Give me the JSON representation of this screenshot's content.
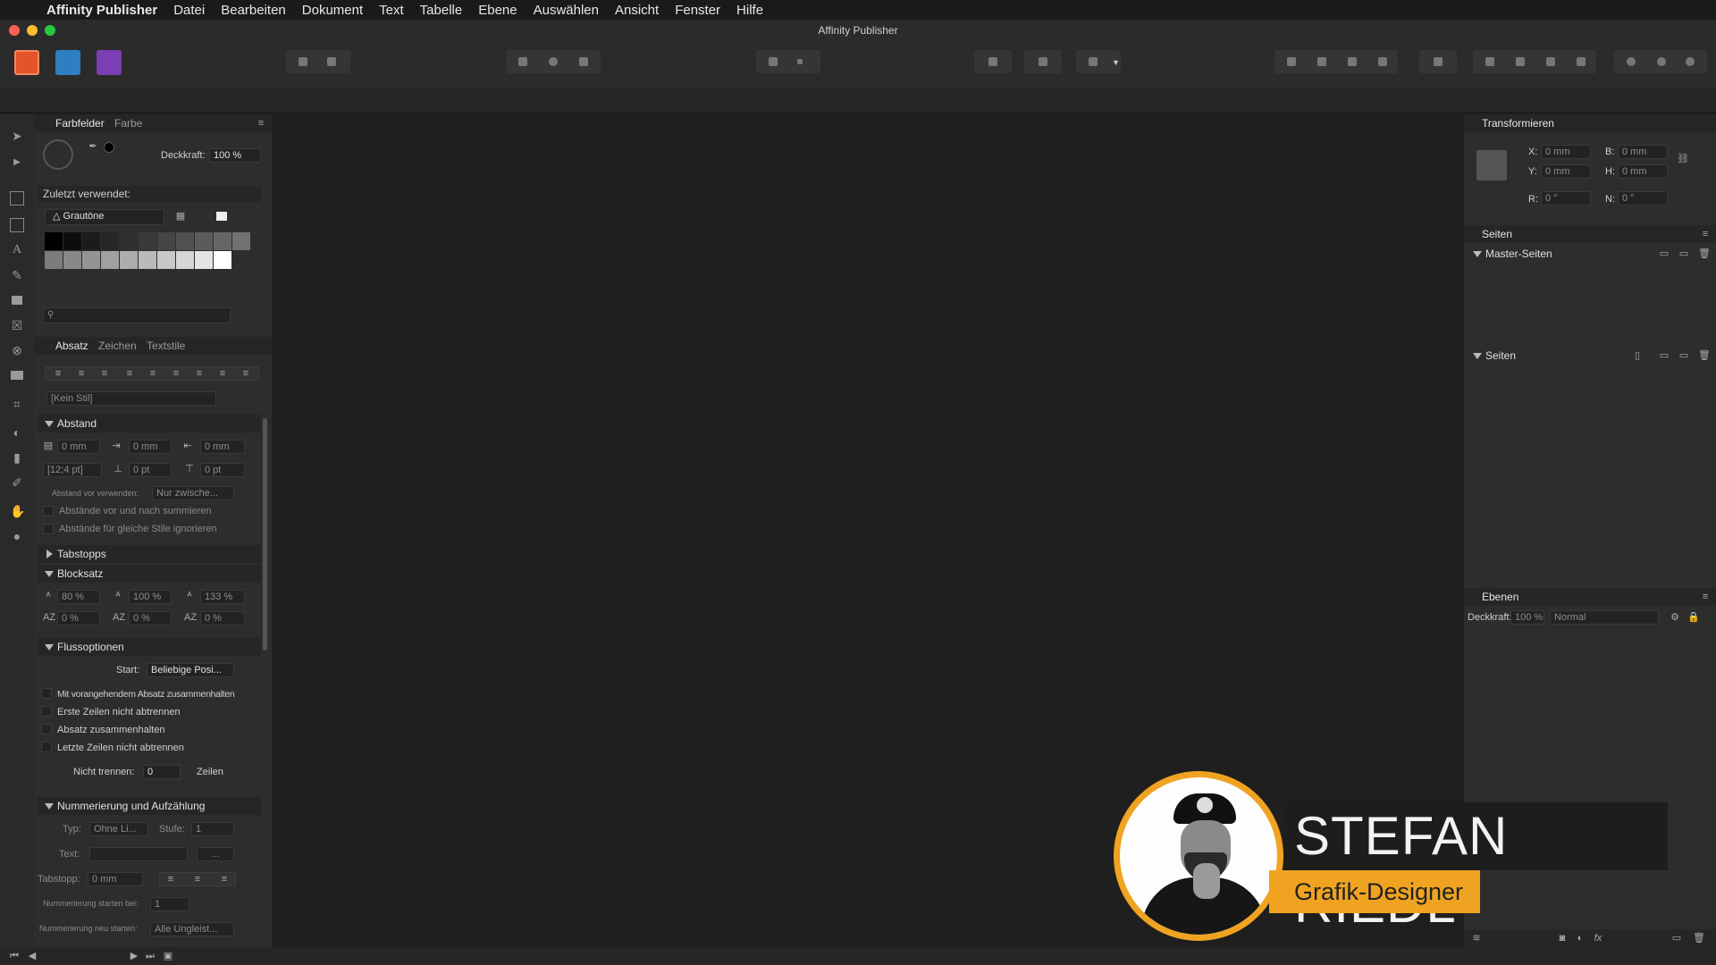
{
  "menubar": {
    "app_name": "Affinity Publisher",
    "items": [
      "Datei",
      "Bearbeiten",
      "Dokument",
      "Text",
      "Tabelle",
      "Ebene",
      "Auswählen",
      "Ansicht",
      "Fenster",
      "Hilfe"
    ]
  },
  "window": {
    "title": "Affinity Publisher"
  },
  "colors": {
    "accent": "#f0a321",
    "panel": "#2d2d2d",
    "canvas": "#1f1f1f"
  },
  "left_panel": {
    "swatches": {
      "tabs": [
        "Farbfelder",
        "Farbe"
      ],
      "opacity_label": "Deckkraft:",
      "opacity_value": "100 %",
      "recent_label": "Zuletzt verwendet:",
      "palette_name": "Grautöne",
      "search_placeholder": ""
    },
    "paragraph": {
      "tabs": [
        "Absatz",
        "Zeichen",
        "Textstile"
      ],
      "style_value": "[Kein Stil]",
      "sections": {
        "abstand": "Abstand",
        "tabstopps": "Tabstopps",
        "blocksatz": "Blocksatz",
        "fluss": "Flussoptionen",
        "nummerierung": "Nummerierung und Aufzählung"
      },
      "abstand": {
        "row1": [
          "0 mm",
          "0 mm",
          "0 mm"
        ],
        "row2": [
          "[12;4 pt]",
          "0 pt",
          "0 pt"
        ],
        "vor_label": "Abstand vor verwenden:",
        "vor_value": "Nur zwische...",
        "chk1": "Abstände vor und nach summieren",
        "chk2": "Abstände für gleiche Stile ignorieren"
      },
      "blocksatz": {
        "row1": [
          "80 %",
          "100 %",
          "133 %"
        ],
        "row2": [
          "0 %",
          "0 %",
          "0 %"
        ]
      },
      "fluss": {
        "start_label": "Start:",
        "start_value": "Beliebige Posi...",
        "chk1": "Mit vorangehendem Absatz zusammenhalten",
        "chk2": "Erste Zeilen nicht abtrennen",
        "chk3": "Absatz zusammenhalten",
        "chk4": "Letzte Zeilen nicht abtrennen",
        "nicht_label": "Nicht trennen:",
        "nicht_value": "0",
        "zeilen_label": "Zeilen"
      },
      "nummerierung": {
        "typ_label": "Typ:",
        "typ_value": "Ohne Li...",
        "stufe_label": "Stufe:",
        "stufe_value": "1",
        "text_label": "Text:",
        "text_btn": "...",
        "tab_label": "Tabstopp:",
        "tab_value": "0 mm",
        "start_label": "Nummerierung starten bei:",
        "start_value": "1",
        "neu_label": "Nummerierung neu starten:",
        "neu_value": "Alle Ungleist..."
      }
    }
  },
  "right_panel": {
    "transform": {
      "title": "Transformieren",
      "x_label": "X:",
      "x_value": "0 mm",
      "y_label": "Y:",
      "y_value": "0 mm",
      "b_label": "B:",
      "b_value": "0 mm",
      "h_label": "H:",
      "h_value": "0 mm",
      "r_label": "R:",
      "r_value": "0 °",
      "n_label": "N:",
      "n_value": "0 °"
    },
    "pages": {
      "title": "Seiten",
      "master_label": "Master-Seiten",
      "pages_label": "Seiten"
    },
    "layers": {
      "title": "Ebenen",
      "opacity_label": "Deckkraft:",
      "opacity_value": "100 %",
      "blend_value": "Normal",
      "fx_label": "fx"
    }
  },
  "overlay": {
    "name": "STEFAN RIEDL",
    "role": "Grafik-Designer"
  }
}
